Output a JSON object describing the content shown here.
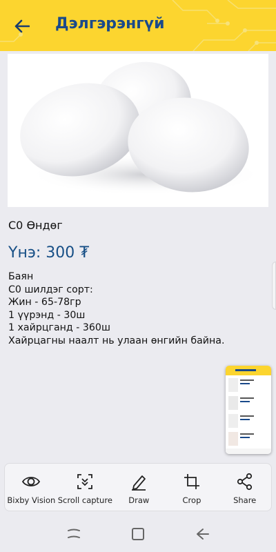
{
  "header": {
    "title": "Дэлгэрэнгүй"
  },
  "product": {
    "name": "С0 Өндөг",
    "price": "Үнэ: 300 ₮",
    "description": [
      "Баян",
      "С0 шилдэг сорт:",
      "Жин - 65-78гр",
      "1 үүрэнд - 30ш",
      "1 хайрцганд - 360ш",
      "Хайрцагны наалт нь улаан өнгийн байна."
    ]
  },
  "toolbar": {
    "items": [
      {
        "label": "Bixby Vision",
        "icon": "eye-icon"
      },
      {
        "label": "Scroll capture",
        "icon": "scroll-capture-icon"
      },
      {
        "label": "Draw",
        "icon": "pen-icon"
      },
      {
        "label": "Crop",
        "icon": "crop-icon"
      },
      {
        "label": "Share",
        "icon": "share-icon"
      }
    ]
  },
  "navbar": {
    "icons": [
      "recents-icon",
      "home-icon",
      "back-icon"
    ]
  },
  "colors": {
    "appbar": "#fcd52f",
    "title": "#1a4a8a",
    "price": "#174f86",
    "background": "#ebebf0"
  }
}
